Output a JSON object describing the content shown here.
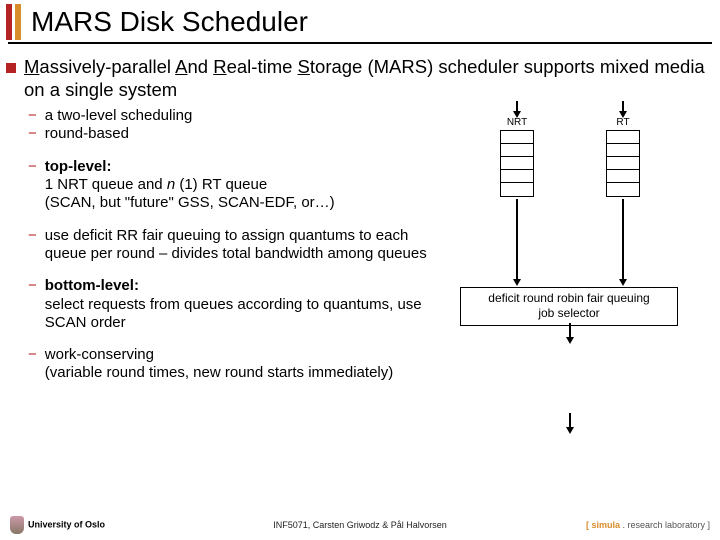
{
  "title": "MARS Disk Scheduler",
  "intro": {
    "prefix": "M",
    "p1": "assively-parallel ",
    "a": "A",
    "p2": "nd ",
    "r": "R",
    "p3": "eal-time ",
    "s": "S",
    "p4": "torage (MARS) scheduler supports mixed media on a single system"
  },
  "bullets": [
    {
      "text": "a two-level scheduling"
    },
    {
      "text": "round-based"
    },
    {
      "lead": "top-level:",
      "text": "1 NRT queue and ",
      "ital": "n",
      "after": " (1) RT queue\n(SCAN, but \"future\" GSS, SCAN-EDF, or…)"
    },
    {
      "text": "use deficit RR fair queuing to assign quantums to each queue per round – divides total bandwidth among queues"
    },
    {
      "lead": "bottom-level:",
      "text": "select requests from queues according to quantums, use SCAN order"
    },
    {
      "text": "work-conserving\n(variable round times, new round starts immediately)"
    }
  ],
  "diagram": {
    "q1_label": "NRT",
    "q2_label": "RT",
    "selector_l1": "deficit round robin fair queuing",
    "selector_l2": "job selector"
  },
  "footer": {
    "university": "University of Oslo",
    "course": "INF5071, Carsten Griwodz & Pål Halvorsen",
    "simula_bracket_open": "[ ",
    "simula_name": "simula",
    "simula_rest": " . research laboratory ]"
  }
}
